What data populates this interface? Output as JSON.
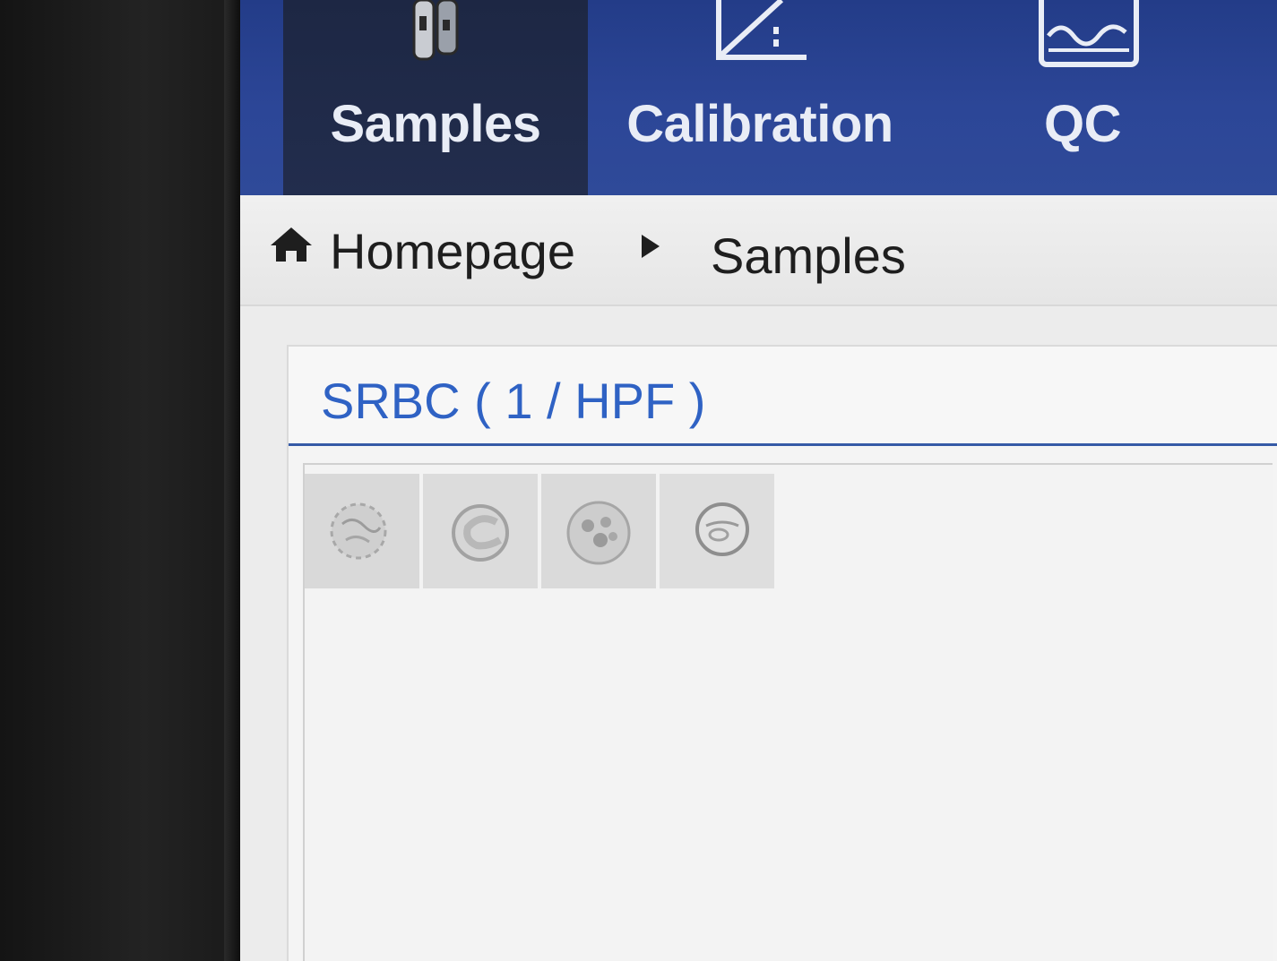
{
  "nav": {
    "tabs": [
      {
        "label": "Samples",
        "icon": "sample-tubes-icon",
        "active": true
      },
      {
        "label": "Calibration",
        "icon": "calibration-icon",
        "active": false
      },
      {
        "label": "QC",
        "icon": "qc-waveform-icon",
        "active": false
      }
    ]
  },
  "breadcrumb": {
    "home_icon": "home-icon",
    "home_label": "Homepage",
    "separator_icon": "triangle-right-icon",
    "current_label": "Samples"
  },
  "panel": {
    "title": "SRBC ( 1 / HPF )",
    "thumbnail_count": 4
  },
  "colors": {
    "nav_background": "#2c4697",
    "nav_active": "#222d4d",
    "panel_accent": "#2f62c4"
  }
}
